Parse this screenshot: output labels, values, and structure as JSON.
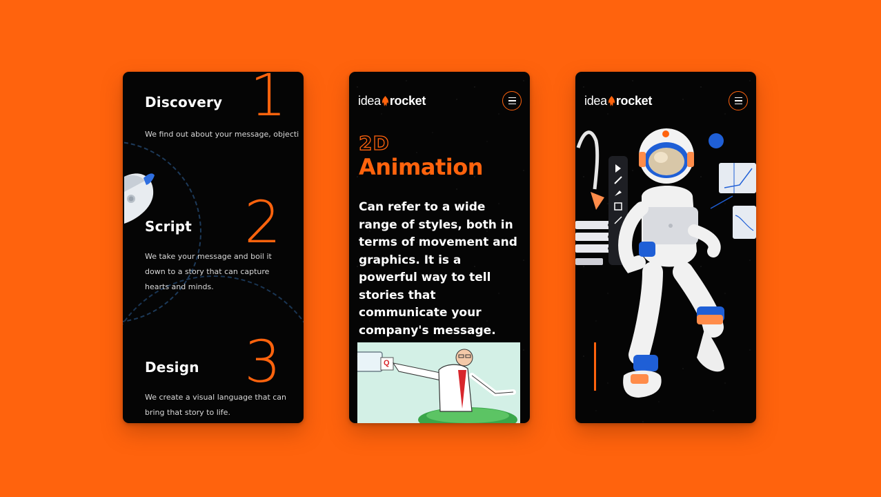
{
  "colors": {
    "background": "#ff630d",
    "phone": "#050505",
    "accent": "#ff630d",
    "text": "#ffffff"
  },
  "process_screen": {
    "steps": [
      {
        "title": "Discovery",
        "number": "1",
        "description": "We find out about your message, objecti"
      },
      {
        "title": "Script",
        "number": "2",
        "description": "We take your message and boil it down to a story that can capture hearts and minds."
      },
      {
        "title": "Design",
        "number": "3",
        "description": "We create a visual language that can bring that story to life."
      }
    ],
    "illustration": "rocket-icon"
  },
  "animation_screen": {
    "logo": {
      "left": "idea",
      "right": "rocket"
    },
    "menu_icon": "hamburger-menu-icon",
    "heading_small": "2D",
    "heading_big": "Animation",
    "body": "Can refer to a wide range of styles, both in terms of movement and graphics. It is a powerful way to tell stories that communicate your company's message.",
    "cartoon_card_label": "Q"
  },
  "astronaut_screen": {
    "logo": {
      "left": "idea",
      "right": "rocket"
    },
    "menu_icon": "hamburger-menu-icon",
    "illustration": "astronaut-illustration",
    "toolbar_icons": [
      "cursor-icon",
      "brush-icon",
      "pen-icon",
      "crop-icon",
      "magic-wand-icon"
    ]
  }
}
